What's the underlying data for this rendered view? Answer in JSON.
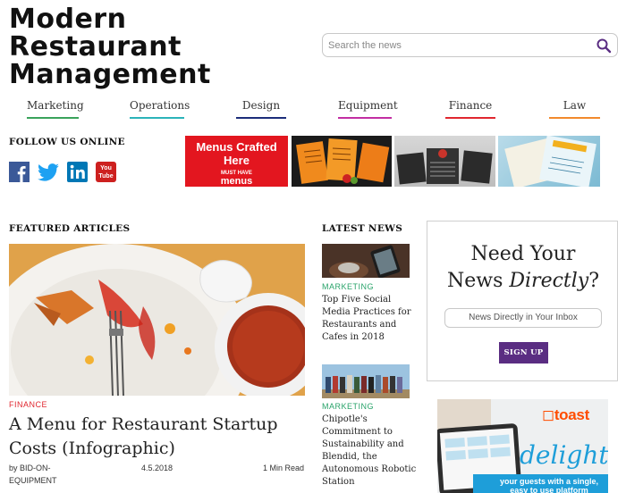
{
  "logo": {
    "line1": "Modern",
    "line2": "Restaurant",
    "line3": "Management"
  },
  "search": {
    "placeholder": "Search the news"
  },
  "nav": [
    {
      "label": "Marketing",
      "color": "#3aa35b"
    },
    {
      "label": "Operations",
      "color": "#2bb3b9"
    },
    {
      "label": "Design",
      "color": "#1c2d7a"
    },
    {
      "label": "Equipment",
      "color": "#c22ea3"
    },
    {
      "label": "Finance",
      "color": "#e0272f"
    },
    {
      "label": "Law",
      "color": "#f28a2c"
    }
  ],
  "follow": {
    "title": "FOLLOW US ONLINE",
    "networks": [
      "facebook-icon",
      "twitter-icon",
      "linkedin-icon",
      "youtube-icon"
    ],
    "youtube_text": "You Tube"
  },
  "ads": {
    "menus": {
      "line1": "Menus Crafted",
      "line2": "Here",
      "tag1": "MUST HAVE",
      "tag2": "menus"
    }
  },
  "featured": {
    "section_title": "FEATURED ARTICLES",
    "category": "FINANCE",
    "title": "A Menu for Restaurant Startup Costs (Infographic)",
    "author_prefix": "by",
    "author_line1": "BID-ON-",
    "author_line2": "EQUIPMENT",
    "date": "4.5.2018",
    "read_time": "1 Min Read"
  },
  "latest": {
    "section_title": "LATEST NEWS",
    "items": [
      {
        "category": "MARKETING",
        "title": "Top Five Social Media Practices for Restaurants and Cafes in 2018"
      },
      {
        "category": "MARKETING",
        "title": "Chipotle's Commitment to Sustainability and Blendid, the Autonomous Robotic Station"
      }
    ]
  },
  "signup": {
    "line1": "Need Your",
    "line2_a": "News ",
    "line2_em": "Directly",
    "line2_b": "?",
    "input_placeholder": "News Directly in Your Inbox",
    "button": "SIGN UP"
  },
  "toast_ad": {
    "brand": "toast",
    "headline": "delight",
    "sub_line1": "your guests with a single,",
    "sub_line2": "easy to use platform"
  },
  "colors": {
    "finance": "#e0272f",
    "marketing": "#29a36a",
    "signup_button": "#5a2d82",
    "toast": "#ff4c00"
  }
}
